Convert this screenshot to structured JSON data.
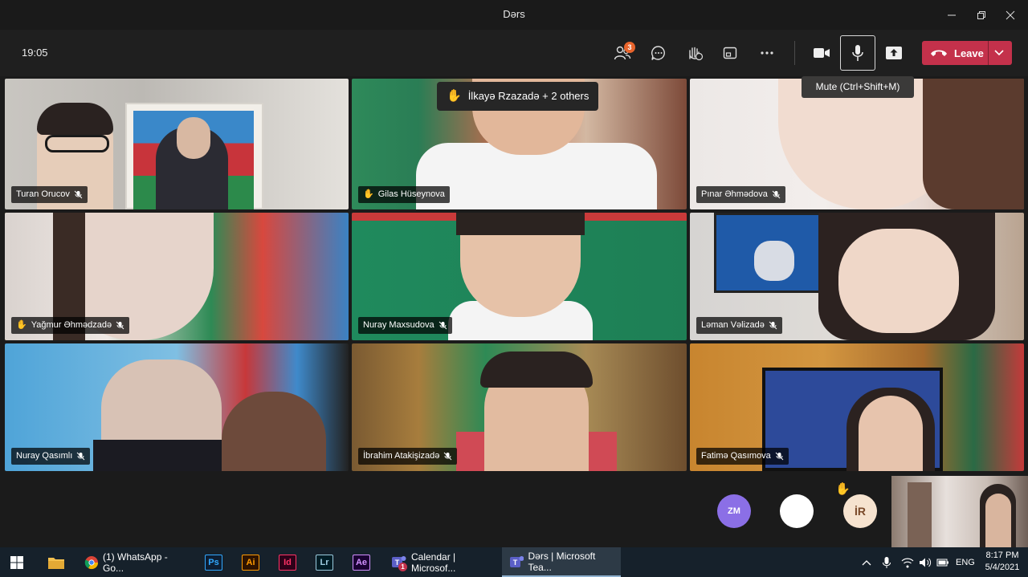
{
  "window": {
    "title": "Dərs"
  },
  "toolbar": {
    "clock": "19:05",
    "participants_badge": "3",
    "leave_label": "Leave"
  },
  "tooltip": {
    "mic": "Mute (Ctrl+Shift+M)"
  },
  "raised_hands_banner": "İlkayə Rzazadə + 2 others",
  "participants": [
    {
      "name": "Turan Orucov",
      "hand_raised": false,
      "muted": true
    },
    {
      "name": "Gilas Hüseynova",
      "hand_raised": true,
      "muted": false
    },
    {
      "name": "Pınar Əhmədova",
      "hand_raised": false,
      "muted": true
    },
    {
      "name": "Yağmur Əhmədzadə",
      "hand_raised": true,
      "muted": true,
      "active_speaker": true
    },
    {
      "name": "Nuray Maxsudova",
      "hand_raised": false,
      "muted": true
    },
    {
      "name": "Ləman Vəlizadə",
      "hand_raised": false,
      "muted": true
    },
    {
      "name": "Nuray Qasımlı",
      "hand_raised": false,
      "muted": true
    },
    {
      "name": "İbrahim Atakişizadə",
      "hand_raised": false,
      "muted": true
    },
    {
      "name": "Fatimə Qasımova",
      "hand_raised": false,
      "muted": true
    }
  ],
  "overflow_avatars": [
    {
      "initials": "ZM",
      "color": "#8b6fe6"
    },
    {
      "initials": "",
      "color": "#ffffff"
    },
    {
      "initials": "İR",
      "color": "#f6e3cf",
      "hand_raised": true
    }
  ],
  "taskbar": {
    "windows": [
      {
        "label": "(1) WhatsApp - Go..."
      },
      {
        "label": "Calendar | Microsof...",
        "badge": "1"
      },
      {
        "label": "Dərs | Microsoft Tea..."
      }
    ],
    "apps": [
      "Ps",
      "Ai",
      "Id",
      "Lr",
      "Ae"
    ],
    "language": "ENG",
    "time": "8:17 PM",
    "date": "5/4/2021"
  },
  "colors": {
    "leave": "#c4314b",
    "active_tile": "#f2c94c",
    "badge": "#e8642c"
  }
}
